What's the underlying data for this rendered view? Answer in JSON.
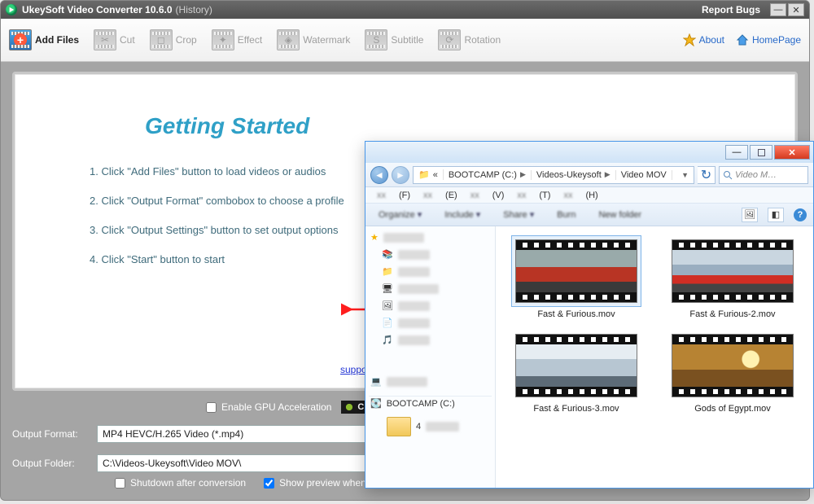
{
  "window": {
    "title": "UkeySoft Video Converter 10.6.0",
    "title_suffix": "(History)",
    "report": "Report Bugs"
  },
  "toolbar": {
    "add": "Add Files",
    "cut": "Cut",
    "crop": "Crop",
    "effect": "Effect",
    "watermark": "Watermark",
    "subtitle": "Subtitle",
    "rotation": "Rotation",
    "about": "About",
    "homepage": "HomePage"
  },
  "getting_started": {
    "title": "Getting Started",
    "steps": [
      "1. Click \"Add Files\" button to load videos or audios",
      "2. Click \"Output Format\" combobox  to choose  a profile",
      "3. Click \"Output Settings\" button to set output options",
      "4. Click \"Start\" button to start"
    ],
    "support": "support@"
  },
  "gpu": {
    "label": "Enable GPU Acceleration",
    "badge": "CU"
  },
  "output_format": {
    "label": "Output Format:",
    "value": "MP4 HEVC/H.265 Video (*.mp4)"
  },
  "output_folder": {
    "label": "Output Folder:",
    "value": "C:\\Videos-Ukeysoft\\Video MOV\\"
  },
  "checks": {
    "shutdown": "Shutdown after conversion",
    "preview": "Show preview when conversion"
  },
  "explorer": {
    "breadcrumb": [
      "BOOTCAMP (C:)",
      "Videos-Ukeysoft",
      "Video MOV"
    ],
    "search_placeholder": "Video M…",
    "menu": [
      "(F)",
      "(E)",
      "(V)",
      "(T)",
      "(H)"
    ],
    "tree": {
      "drive": "BOOTCAMP (C:)",
      "folder_count": "4"
    },
    "files": [
      {
        "name": "Fast & Furious.mov",
        "selected": true,
        "img": "car-red"
      },
      {
        "name": "Fast & Furious-2.mov",
        "selected": false,
        "img": "car-red2"
      },
      {
        "name": "Fast & Furious-3.mov",
        "selected": false,
        "img": "car-grey"
      },
      {
        "name": "Gods of Egypt.mov",
        "selected": false,
        "img": "egypt"
      }
    ]
  }
}
